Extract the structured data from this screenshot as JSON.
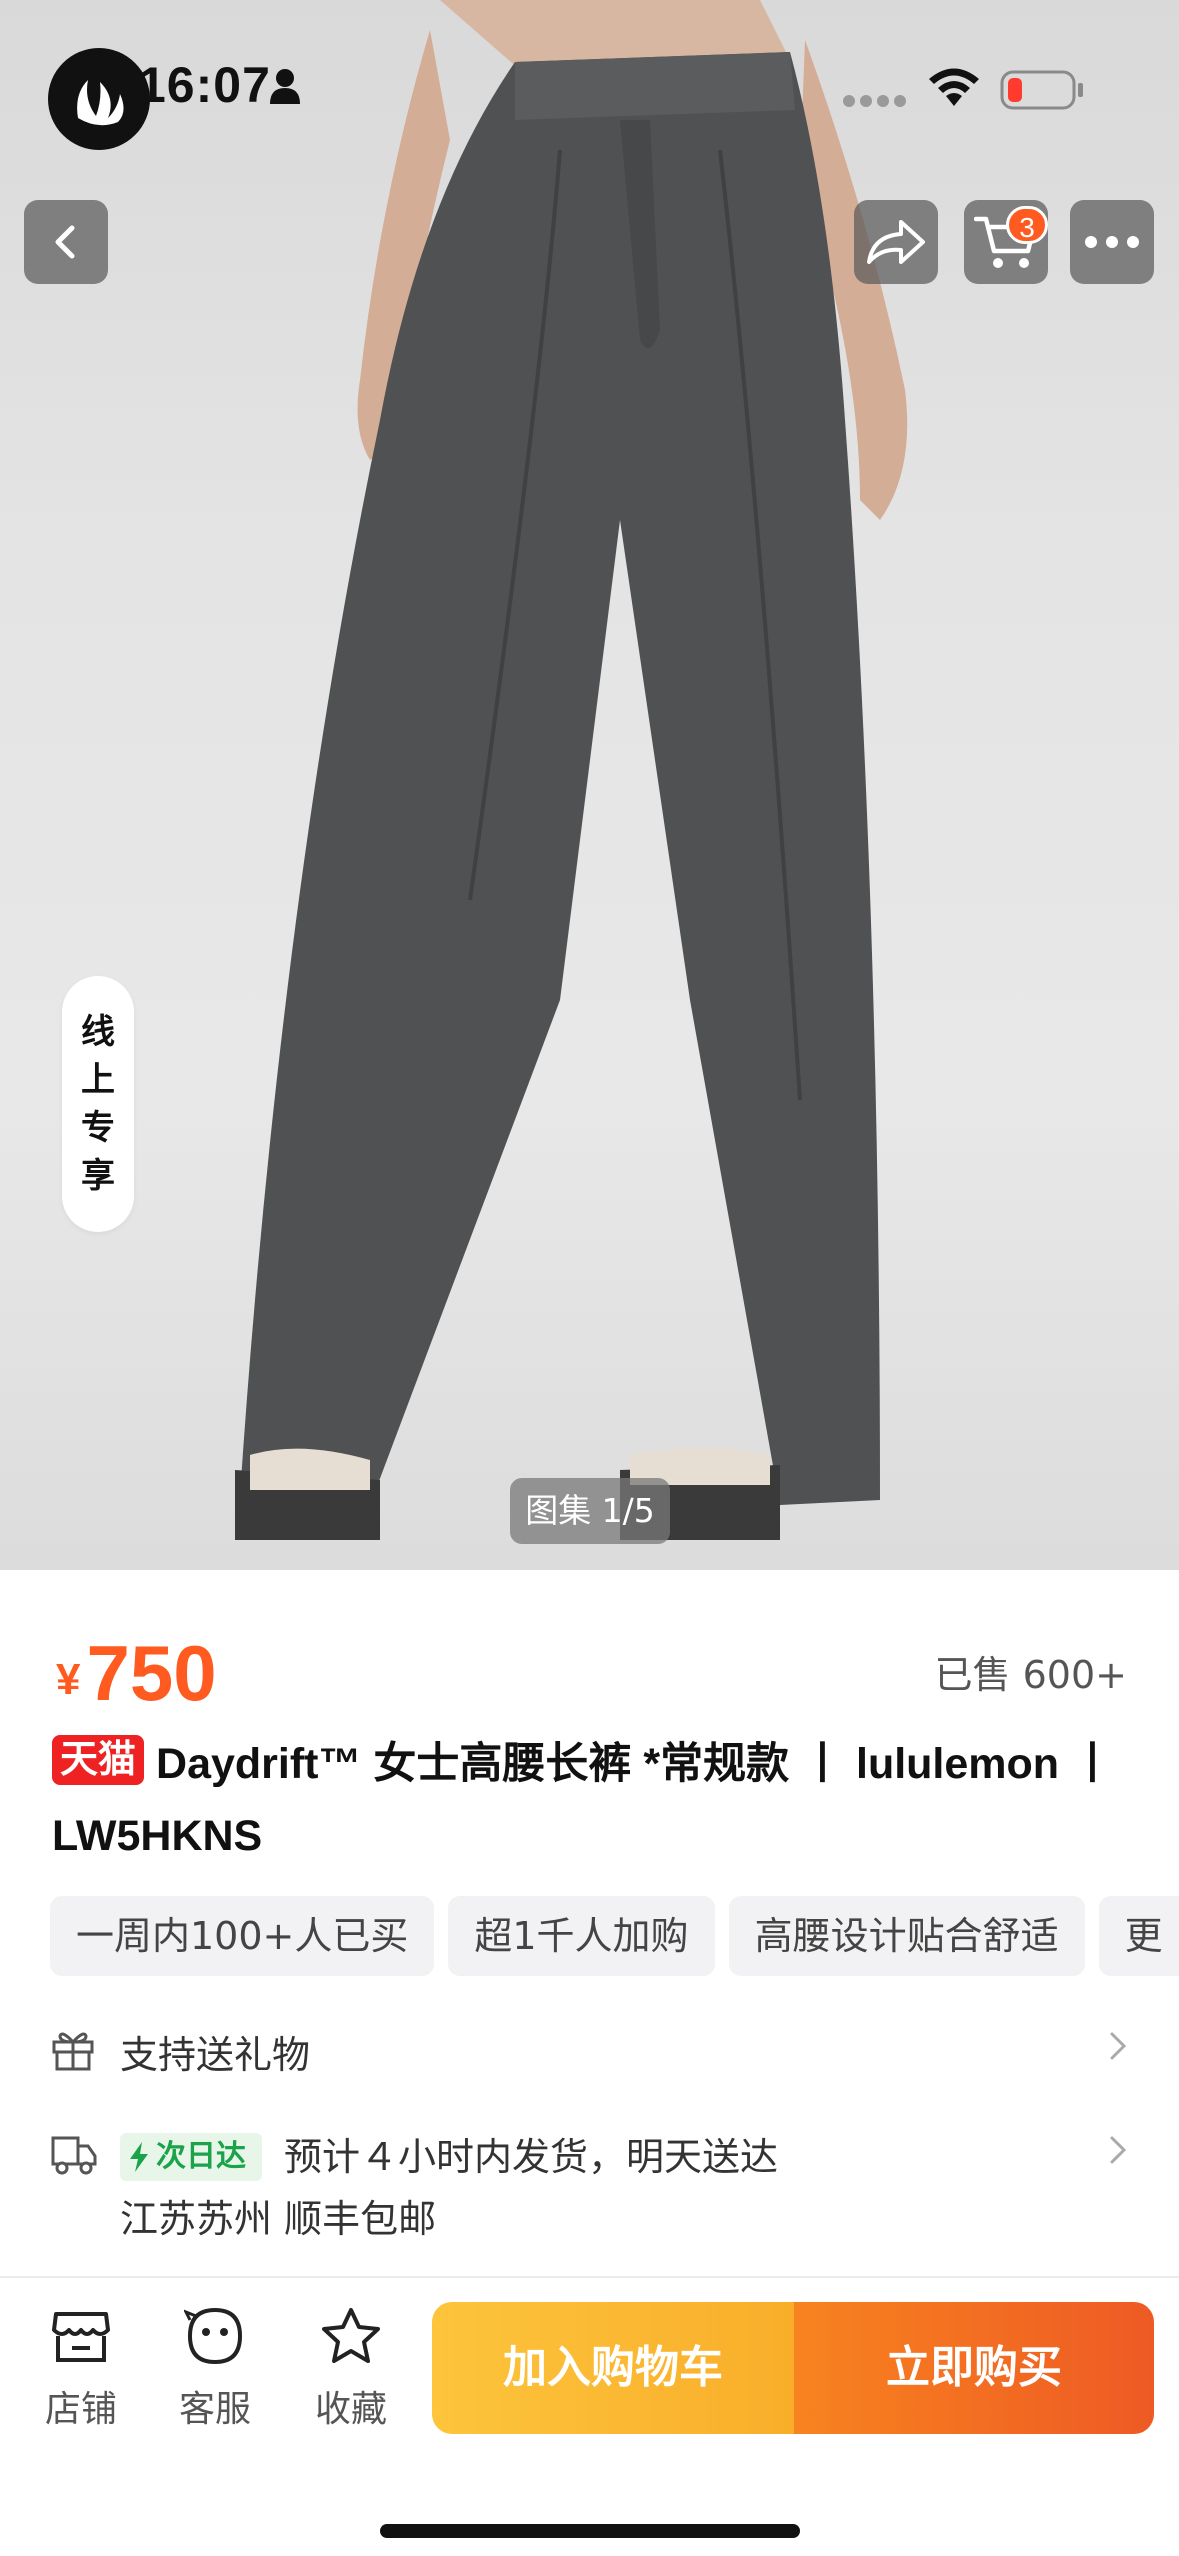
{
  "status_bar": {
    "time": "16:07"
  },
  "nav": {
    "cart_count": "3"
  },
  "hero": {
    "online_exclusive": [
      "线",
      "上",
      "专",
      "享"
    ],
    "gallery_indicator": "图集 1/5"
  },
  "product": {
    "currency": "¥",
    "price": "750",
    "sold": "已售 600+",
    "store_badge": "天猫",
    "title": "Daydrift™ 女士高腰长裤 *常规款 丨 lululemon 丨 LW5HKNS",
    "tags": [
      "一周内100+人已买",
      "超1千人加购",
      "高腰设计贴合舒适",
      "更"
    ]
  },
  "services": {
    "gift": "支持送礼物",
    "shipping_badge": "次日达",
    "shipping_text": "预计４小时内发货，明天送达",
    "origin": "江苏苏州  顺丰包邮"
  },
  "bottom_bar": {
    "store": "店铺",
    "service": "客服",
    "favorite": "收藏",
    "add_to_cart": "加入购物车",
    "buy_now": "立即购买"
  },
  "colors": {
    "accent": "#ff5a1f",
    "cart_button": "#fdc43c",
    "buy_button": "#ee5a24",
    "tmall_red": "#e22222"
  }
}
